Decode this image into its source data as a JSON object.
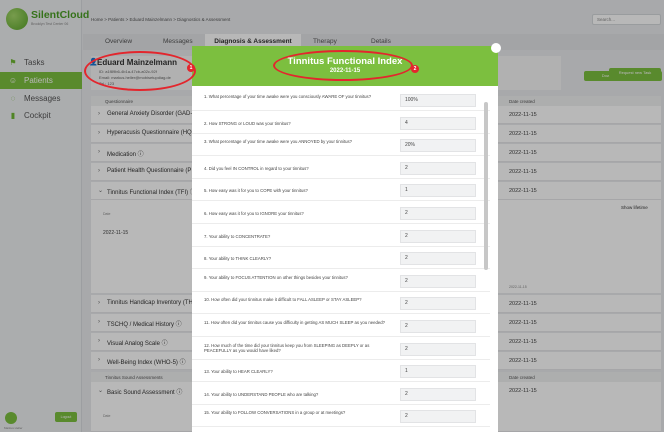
{
  "app": {
    "brand": "SilentCloud",
    "brand_sub": "Brooklyn Test Center 06"
  },
  "sidebar": {
    "items": [
      {
        "label": "Tasks",
        "icon": "flag-icon"
      },
      {
        "label": "Patients",
        "icon": "people-icon"
      },
      {
        "label": "Messages",
        "icon": "chat-icon"
      },
      {
        "label": "Cockpit",
        "icon": "chart-icon"
      }
    ],
    "user": "Markus Heller",
    "logout": "Logout"
  },
  "header": {
    "breadcrumb": "Home > Patients > Eduard Mainzelmann > Diagnostics & Assessment",
    "search_placeholder": "Search...",
    "download": "Download patient report"
  },
  "tabs": [
    "Overview",
    "Messages",
    "Diagnosis & Assessment",
    "Therapy",
    "Details"
  ],
  "patient": {
    "name": "Eduard Mainzelmann",
    "id": "ID: a1f89b6-4b1a-47cb-a02c-92f",
    "email": "Email: markus.heller@mobisetupdiag.de",
    "tel": "Tel.: 123",
    "request_task": "Request new Task"
  },
  "table": {
    "col_questionnaire": "Questionnaire",
    "col_date": "Date created",
    "col_tinnitus_sound": "Tinnitus Sound Assessments",
    "show_lifetime": "Show lifetime",
    "tfi_date": "2022-11-15",
    "tfi_mini_label": "Date",
    "chart_date": "2022-11-15",
    "rows": [
      {
        "label": "General Anxiety Disorder (GAD-",
        "date": "2022-11-15"
      },
      {
        "label": "Hyperacusis Questionnaire (HQ)",
        "date": "2022-11-15"
      },
      {
        "label": "Medication ⓘ",
        "date": "2022-11-15"
      },
      {
        "label": "Patient Health Questionnaire (P",
        "date": "2022-11-15"
      },
      {
        "label": "Tinnitus Functional Index (TFI) ⓘ",
        "date": "2022-11-15"
      },
      {
        "label": "Tinnitus Handicap Inventory (TH",
        "date": "2022-11-15"
      },
      {
        "label": "TSCHQ / Medical History ⓘ",
        "date": "2022-11-15"
      },
      {
        "label": "Visual Analog Scale ⓘ",
        "date": "2022-11-15"
      },
      {
        "label": "Well-Being Index (WHO-5) ⓘ",
        "date": "2022-11-15"
      },
      {
        "label": "Basic Sound Assessment ⓘ",
        "date": "2022-11-15"
      }
    ]
  },
  "modal": {
    "title": "Tinnitus Functional Index",
    "date": "2022-11-15",
    "questions": [
      {
        "q": "1. What percentage of your time awake were you consciously AWARE OF your tinnitus?",
        "a": "100%"
      },
      {
        "q": "2. How STRONG or LOUD was your tinnitus?",
        "a": "4"
      },
      {
        "q": "3. What percentage of your time awake were you ANNOYED by your tinnitus?",
        "a": "20%"
      },
      {
        "q": "4. Did you feel IN CONTROL in regard to your tinnitus?",
        "a": "2"
      },
      {
        "q": "5. How easy was it for you to COPE with your tinnitus?",
        "a": "1"
      },
      {
        "q": "6. How easy was it for you to IGNORE your tinnitus?",
        "a": "2"
      },
      {
        "q": "7. Your ability to CONCENTRATE?",
        "a": "2"
      },
      {
        "q": "8. Your ability to THINK CLEARLY?",
        "a": "2"
      },
      {
        "q": "9. Your ability to FOCUS ATTENTION on other things besides your tinnitus?",
        "a": "2"
      },
      {
        "q": "10. How often did your tinnitus make it difficult to FALL ASLEEP or STAY ASLEEP?",
        "a": "2"
      },
      {
        "q": "11. How often did your tinnitus cause you difficulty in getting AS MUCH SLEEP as you needed?",
        "a": "2"
      },
      {
        "q": "12. How much of the time did your tinnitus keep you from SLEEPING as DEEPLY or as PEACEFULLY as you would have liked?",
        "a": "2"
      },
      {
        "q": "13. Your ability to HEAR CLEARLY?",
        "a": "1"
      },
      {
        "q": "14. Your ability to UNDERSTAND PEOPLE who are talking?",
        "a": "2"
      },
      {
        "q": "15. Your ability to FOLLOW CONVERSATIONS in a group or at meetings?",
        "a": "2"
      }
    ]
  },
  "annotations": {
    "badge1": "1",
    "badge2": "2"
  }
}
